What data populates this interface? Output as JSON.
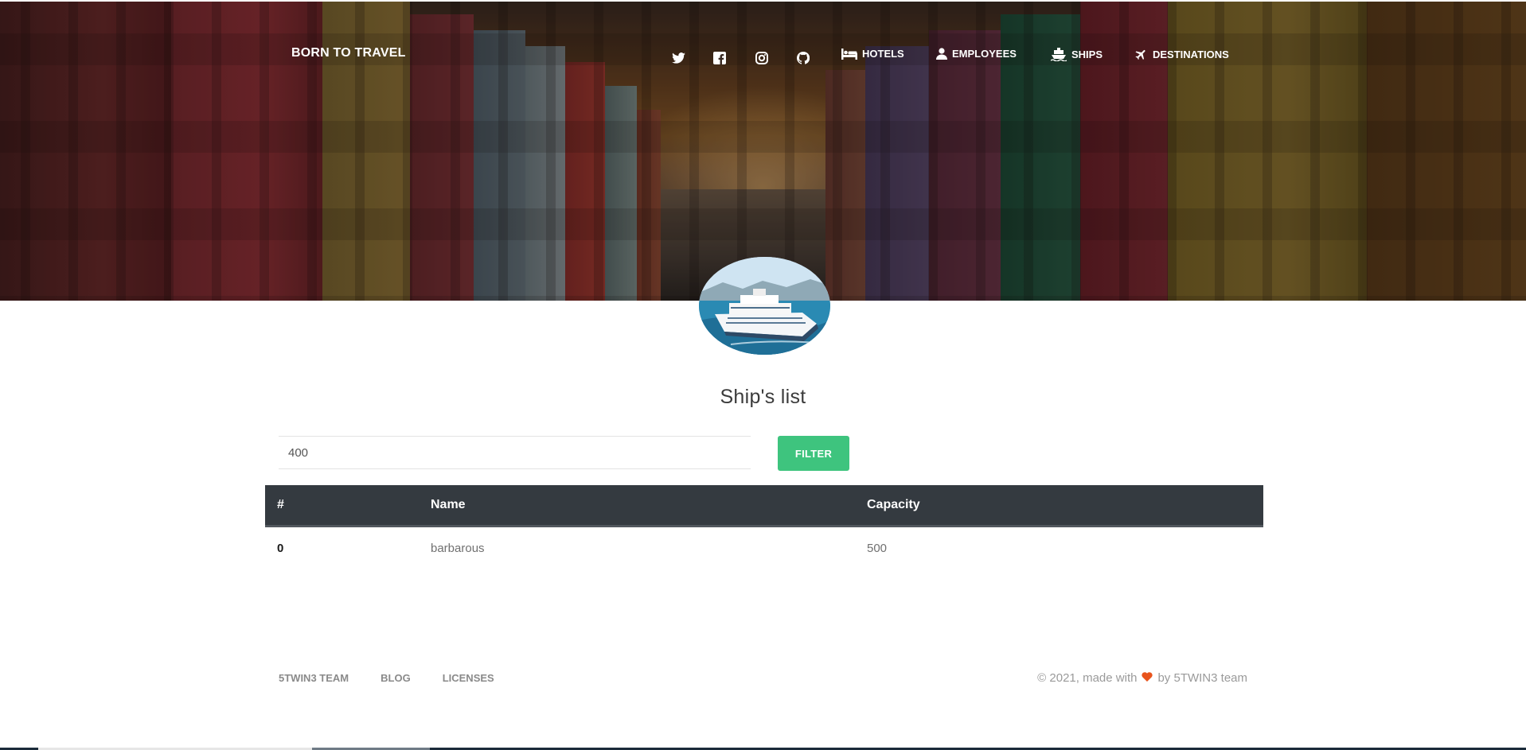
{
  "brand": "BORN TO TRAVEL",
  "nav": {
    "social": [
      "twitter-icon",
      "facebook-icon",
      "instagram-icon",
      "github-icon"
    ],
    "links": [
      {
        "label": "HOTELS",
        "icon": "bed-icon"
      },
      {
        "label": "EMPLOYEES",
        "icon": "user-icon"
      },
      {
        "label": "SHIPS",
        "icon": "ship-icon"
      },
      {
        "label": "DESTINATIONS",
        "icon": "plane-icon"
      }
    ]
  },
  "main": {
    "title": "Ship's list",
    "filter": {
      "value": "400",
      "button_label": "FILTER"
    },
    "table": {
      "headers": [
        "#",
        "Name",
        "Capacity"
      ],
      "rows": [
        {
          "index": "0",
          "name": "barbarous",
          "capacity": "500"
        }
      ]
    }
  },
  "footer": {
    "links": [
      "5TWIN3 TEAM",
      "BLOG",
      "LICENSES"
    ],
    "copyright_prefix": "© 2021, made with",
    "copyright_suffix": "by 5TWIN3 team"
  },
  "colors": {
    "accent_green": "#3ec47e",
    "table_header": "#343a40",
    "heart": "#e8541c"
  }
}
